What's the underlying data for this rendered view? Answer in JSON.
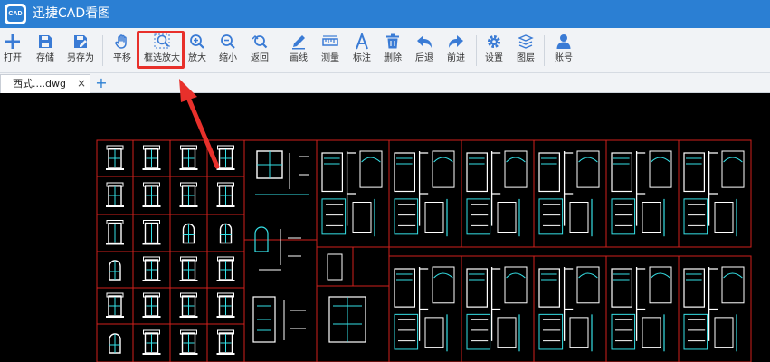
{
  "app": {
    "logo_text": "CAD",
    "title": "迅捷CAD看图"
  },
  "toolbar": {
    "items": [
      {
        "id": "open",
        "label": "打开",
        "icon": "plus-icon"
      },
      {
        "id": "save",
        "label": "存储",
        "icon": "save-icon"
      },
      {
        "id": "save-as",
        "label": "另存为",
        "icon": "save-as-icon"
      },
      {
        "id": "pan",
        "label": "平移",
        "icon": "hand-icon"
      },
      {
        "id": "box-zoom",
        "label": "框选放大",
        "icon": "box-zoom-icon"
      },
      {
        "id": "zoom-in",
        "label": "放大",
        "icon": "zoom-in-icon"
      },
      {
        "id": "zoom-out",
        "label": "缩小",
        "icon": "zoom-out-icon"
      },
      {
        "id": "back",
        "label": "返回",
        "icon": "zoom-back-icon"
      },
      {
        "id": "line",
        "label": "画线",
        "icon": "pencil-icon"
      },
      {
        "id": "measure",
        "label": "测量",
        "icon": "ruler-icon"
      },
      {
        "id": "annotate",
        "label": "标注",
        "icon": "text-a-icon"
      },
      {
        "id": "delete",
        "label": "删除",
        "icon": "trash-icon"
      },
      {
        "id": "undo",
        "label": "后退",
        "icon": "undo-arrow-icon"
      },
      {
        "id": "redo",
        "label": "前进",
        "icon": "redo-arrow-icon"
      },
      {
        "id": "settings",
        "label": "设置",
        "icon": "gear-icon"
      },
      {
        "id": "layers",
        "label": "图层",
        "icon": "layers-icon"
      },
      {
        "id": "account",
        "label": "账号",
        "icon": "user-icon"
      }
    ]
  },
  "tabs": {
    "active_name": "西式....dwg",
    "close_glyph": "×",
    "new_glyph": "+"
  },
  "colors": {
    "titlebar": "#2b7fd3",
    "toolbar_icon": "#3a7bd5",
    "highlight": "#e8302b",
    "cad_frame": "#d0201c",
    "cad_cyan": "#35e0e6",
    "cad_white": "#ffffff"
  }
}
